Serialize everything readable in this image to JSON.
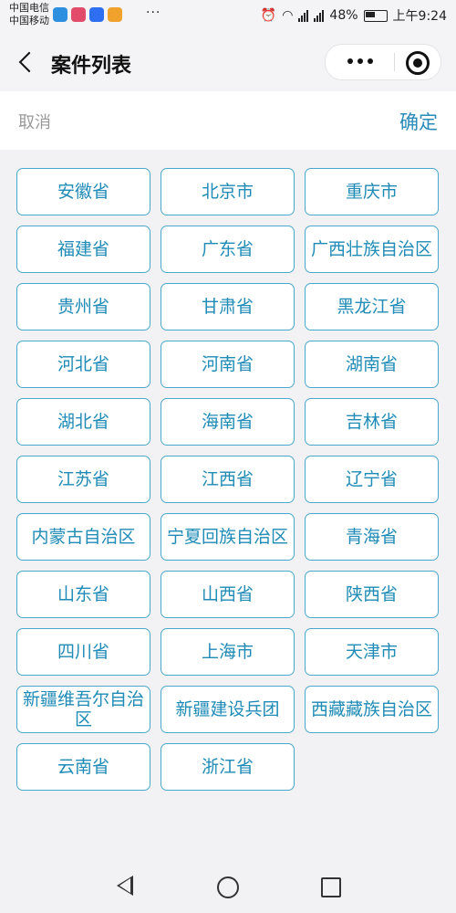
{
  "status_bar": {
    "carrier_1": "中国电信",
    "carrier_2": "中国移动",
    "dots": "···",
    "battery": "48%",
    "time": "上午9:24",
    "app_icon_colors": [
      "#2d8fe0",
      "#e24b6a",
      "#2d6ff0",
      "#f0a22d"
    ]
  },
  "nav": {
    "title": "案件列表"
  },
  "picker": {
    "cancel_label": "取消",
    "confirm_label": "确定"
  },
  "regions": [
    "安徽省",
    "北京市",
    "重庆市",
    "福建省",
    "广东省",
    "广西壮族自治区",
    "贵州省",
    "甘肃省",
    "黑龙江省",
    "河北省",
    "河南省",
    "湖南省",
    "湖北省",
    "海南省",
    "吉林省",
    "江苏省",
    "江西省",
    "辽宁省",
    "内蒙古自治区",
    "宁夏回族自治区",
    "青海省",
    "山东省",
    "山西省",
    "陕西省",
    "四川省",
    "上海市",
    "天津市",
    "新疆维吾尔自治区",
    "新疆建设兵团",
    "西藏藏族自治区",
    "云南省",
    "浙江省"
  ],
  "colors": {
    "accent": "#2a8bb8",
    "cell_border": "#4aa8cc"
  }
}
